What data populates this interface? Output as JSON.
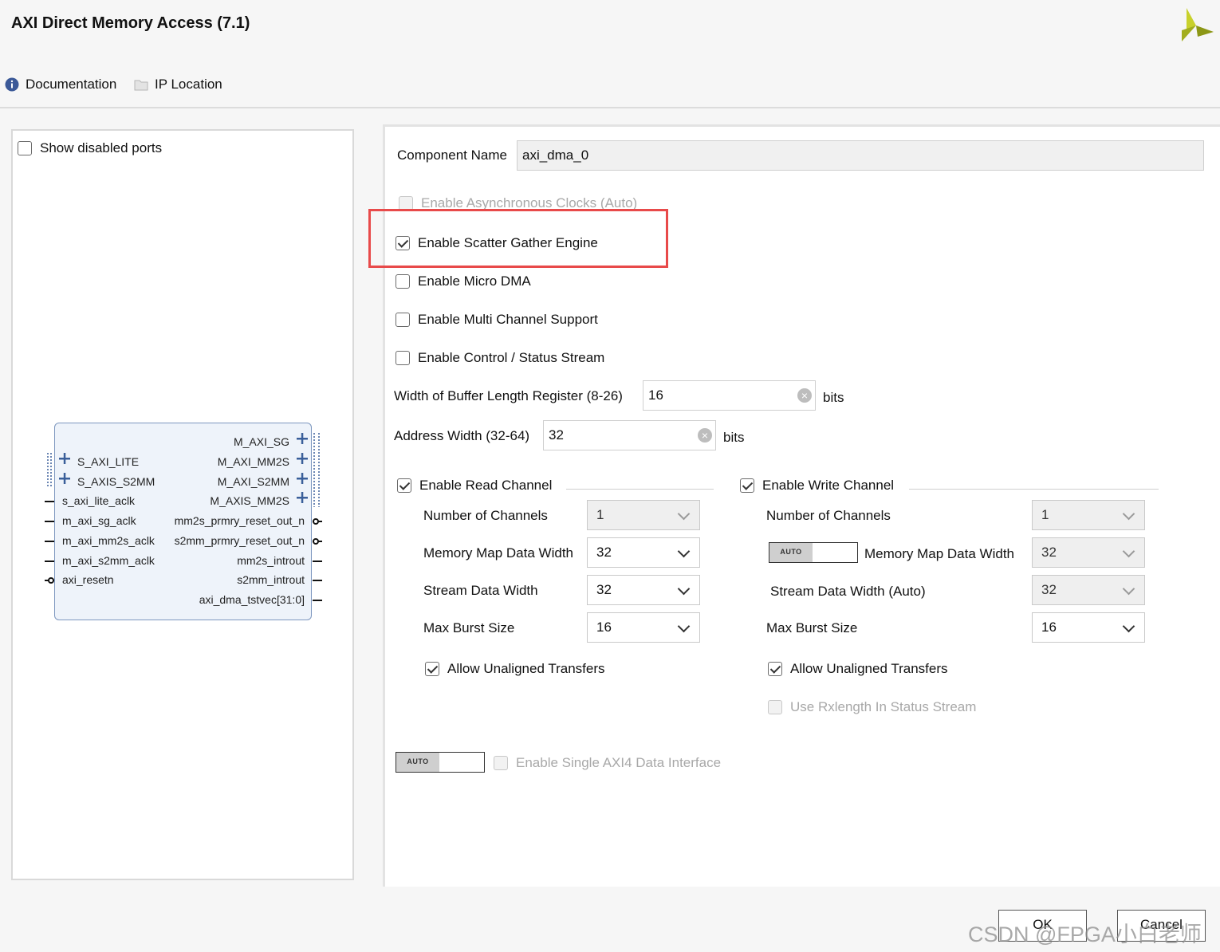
{
  "header": {
    "title": "AXI Direct Memory Access (7.1)",
    "documentation_label": "Documentation",
    "ip_location_label": "IP Location"
  },
  "left_panel": {
    "show_disabled_ports_label": "Show disabled ports",
    "show_disabled_ports_checked": false,
    "block": {
      "right_ports": [
        "M_AXI_SG",
        "M_AXI_MM2S",
        "M_AXI_S2MM",
        "M_AXIS_MM2S",
        "mm2s_prmry_reset_out_n",
        "s2mm_prmry_reset_out_n",
        "mm2s_introut",
        "s2mm_introut",
        "axi_dma_tstvec[31:0]"
      ],
      "left_ports": [
        "S_AXI_LITE",
        "S_AXIS_S2MM",
        "s_axi_lite_aclk",
        "m_axi_sg_aclk",
        "m_axi_mm2s_aclk",
        "m_axi_s2mm_aclk",
        "axi_resetn"
      ]
    }
  },
  "config": {
    "component_name_label": "Component Name",
    "component_name_value": "axi_dma_0",
    "async_clocks_label": "Enable Asynchronous Clocks (Auto)",
    "scatter_gather_label": "Enable Scatter Gather Engine",
    "micro_dma_label": "Enable Micro DMA",
    "multi_channel_label": "Enable Multi Channel Support",
    "control_status_label": "Enable Control / Status Stream",
    "buffer_length_label": "Width of Buffer Length Register (8-26)",
    "buffer_length_value": "16",
    "buffer_length_unit": "bits",
    "address_width_label": "Address Width (32-64)",
    "address_width_value": "32",
    "address_width_unit": "bits",
    "read_channel": {
      "enable_label": "Enable Read Channel",
      "num_channels_label": "Number of Channels",
      "num_channels_value": "1",
      "mm_data_width_label": "Memory Map Data Width",
      "mm_data_width_value": "32",
      "stream_data_width_label": "Stream Data Width",
      "stream_data_width_value": "32",
      "max_burst_label": "Max Burst Size",
      "max_burst_value": "16",
      "unaligned_label": "Allow Unaligned Transfers"
    },
    "write_channel": {
      "enable_label": "Enable Write Channel",
      "num_channels_label": "Number of Channels",
      "num_channels_value": "1",
      "auto_label": "AUTO",
      "mm_data_width_label": "Memory Map Data Width",
      "mm_data_width_value": "32",
      "stream_data_width_label": "Stream Data Width (Auto)",
      "stream_data_width_value": "32",
      "max_burst_label": "Max Burst Size",
      "max_burst_value": "16",
      "unaligned_label": "Allow Unaligned Transfers",
      "rxlength_label": "Use Rxlength In Status Stream"
    },
    "single_axi4_auto_label": "AUTO",
    "single_axi4_label": "Enable Single AXI4 Data Interface"
  },
  "footer": {
    "ok_label": "OK",
    "cancel_label": "Cancel",
    "watermark": "CSDN @FPGA小白老师"
  },
  "colors": {
    "highlight": "#e84a4a",
    "block_fill": "#eef3fa",
    "block_border": "#7d97bf",
    "port_plus": "#3a5f9a",
    "info_icon": "#3b5998"
  }
}
